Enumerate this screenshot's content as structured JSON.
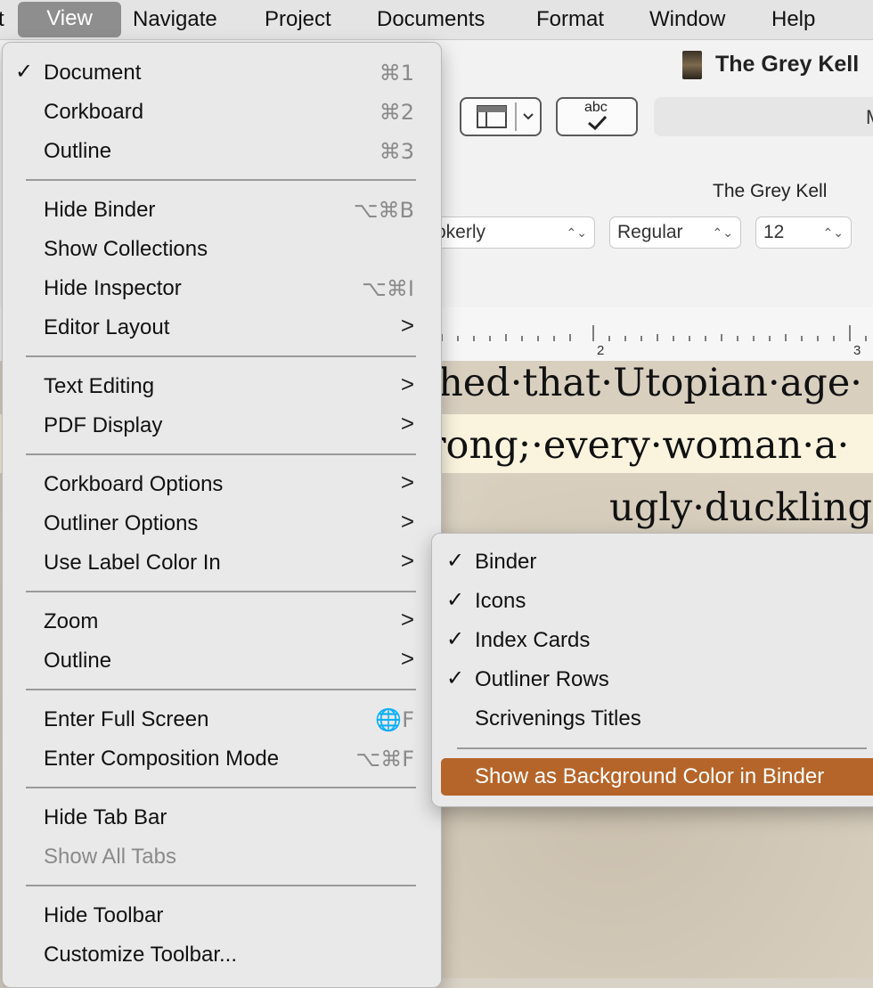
{
  "menubar": {
    "items": [
      {
        "label": "t"
      },
      {
        "label": "View"
      },
      {
        "label": "Navigate"
      },
      {
        "label": "Project"
      },
      {
        "label": "Documents"
      },
      {
        "label": "Format"
      },
      {
        "label": "Window"
      },
      {
        "label": "Help"
      }
    ]
  },
  "window": {
    "title": "The Grey Kell",
    "toolbar_field_text": "M",
    "spell_button_label": "abc",
    "document_header": "The Grey Kell",
    "format": {
      "font": "okerly",
      "style": "Regular",
      "size": "12"
    },
    "ruler": {
      "mark_2": "2",
      "mark_3": "3"
    },
    "text_lines": [
      "ched·that·Utopian·age·",
      "rong;·every·woman·a·",
      "ugly·duckling"
    ]
  },
  "view_menu": {
    "items": [
      {
        "check": "✓",
        "label": "Document",
        "shortcut": "⌘1"
      },
      {
        "check": "",
        "label": "Corkboard",
        "shortcut": "⌘2"
      },
      {
        "check": "",
        "label": "Outline",
        "shortcut": "⌘3"
      },
      {
        "check": "",
        "label": "Hide Binder",
        "shortcut": "⌥⌘B"
      },
      {
        "check": "",
        "label": "Show Collections",
        "shortcut": ""
      },
      {
        "check": "",
        "label": "Hide Inspector",
        "shortcut": "⌥⌘I"
      },
      {
        "check": "",
        "label": "Editor Layout",
        "submenu": ">"
      },
      {
        "check": "",
        "label": "Text Editing",
        "submenu": ">"
      },
      {
        "check": "",
        "label": "PDF Display",
        "submenu": ">"
      },
      {
        "check": "",
        "label": "Corkboard Options",
        "submenu": ">"
      },
      {
        "check": "",
        "label": "Outliner Options",
        "submenu": ">"
      },
      {
        "check": "",
        "label": "Use Label Color In",
        "submenu": ">"
      },
      {
        "check": "",
        "label": "Zoom",
        "submenu": ">"
      },
      {
        "check": "",
        "label": "Outline",
        "submenu": ">"
      },
      {
        "check": "",
        "label": "Enter Full Screen",
        "shortcut": "🌐F"
      },
      {
        "check": "",
        "label": "Enter Composition Mode",
        "shortcut": "⌥⌘F"
      },
      {
        "check": "",
        "label": "Hide Tab Bar",
        "shortcut": ""
      },
      {
        "check": "",
        "label": "Show All Tabs",
        "shortcut": "",
        "disabled": true
      },
      {
        "check": "",
        "label": "Hide Toolbar",
        "shortcut": ""
      },
      {
        "check": "",
        "label": "Customize Toolbar...",
        "shortcut": ""
      }
    ]
  },
  "label_color_submenu": {
    "items": [
      {
        "check": "✓",
        "label": "Binder"
      },
      {
        "check": "✓",
        "label": "Icons"
      },
      {
        "check": "✓",
        "label": "Index Cards"
      },
      {
        "check": "✓",
        "label": "Outliner Rows"
      },
      {
        "check": "",
        "label": "Scrivenings Titles"
      },
      {
        "check": "",
        "label": "Show as Background Color in Binder",
        "highlighted": true
      }
    ]
  },
  "colors": {
    "highlight": "#b5652a",
    "menu_bg": "#e9e9e9",
    "menubar_active": "#8e8e8e"
  }
}
